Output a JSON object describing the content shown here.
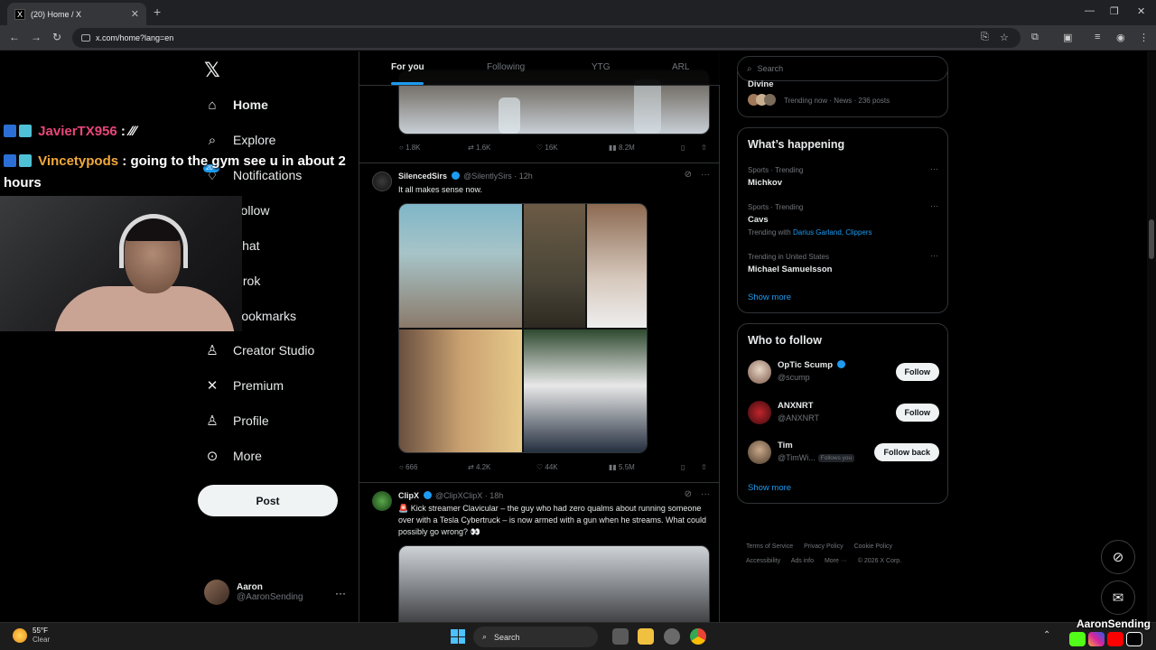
{
  "browser": {
    "tab_title": "(20) Home / X",
    "url": "x.com/home?lang=en"
  },
  "sidebar": {
    "items": [
      {
        "label": "Home",
        "icon": "home-icon",
        "active": true
      },
      {
        "label": "Explore",
        "icon": "search-icon"
      },
      {
        "label": "Notifications",
        "icon": "bell-icon"
      },
      {
        "label": "Follow",
        "icon": "follow-icon"
      },
      {
        "label": "Chat",
        "icon": "chat-icon"
      },
      {
        "label": "Grok",
        "icon": "grok-icon"
      },
      {
        "label": "Bookmarks",
        "icon": "bookmark-icon"
      },
      {
        "label": "Creator Studio",
        "icon": "creator-studio-icon"
      },
      {
        "label": "Premium",
        "icon": "x-premium-icon"
      },
      {
        "label": "Profile",
        "icon": "person-icon"
      },
      {
        "label": "More",
        "icon": "more-circle-icon"
      }
    ],
    "post_label": "Post",
    "notif_badge": "20+",
    "account": {
      "name": "Aaron",
      "handle": "@AaronSending"
    }
  },
  "overlay": {
    "chat": [
      {
        "user": "JavierTX956",
        "sep": " : ",
        "message": "∕∕∕"
      },
      {
        "user": "Vincetypods",
        "sep": " : ",
        "message": "going to the gym see u in about 2 hours"
      }
    ],
    "streamer_name": "AaronSending"
  },
  "feed": {
    "tabs": [
      "For you",
      "Following",
      "YTG",
      "ARL"
    ],
    "active_tab": "For you",
    "posts": [
      {
        "stats": {
          "replies": "1.8K",
          "reposts": "1.6K",
          "likes": "16K",
          "views": "8.2M"
        }
      },
      {
        "name": "SilencedSirs",
        "handle": "@SilentlySirs",
        "time": "12h",
        "text": "It all makes sense now.",
        "stats": {
          "replies": "666",
          "reposts": "4.2K",
          "likes": "44K",
          "views": "5.5M"
        }
      },
      {
        "name": "ClipX",
        "handle": "@ClipXClipX",
        "time": "18h",
        "text": "🚨 Kick streamer Clavicular – the guy who had zero qualms about running someone over with a Tesla Cybertruck – is now armed with a gun when he streams. What could possibly go wrong? 👀"
      }
    ]
  },
  "right": {
    "search_placeholder": "Search",
    "top_trend": {
      "name": "Divine",
      "sub": "Trending now · News · 236 posts"
    },
    "whats_happening": {
      "title": "What’s happening",
      "trends": [
        {
          "category": "Sports · Trending",
          "name": "Michkov"
        },
        {
          "category": "Sports · Trending",
          "name": "Cavs",
          "sub_prefix": "Trending with",
          "links": "Darius Garland, Clippers"
        },
        {
          "category": "Trending in United States",
          "name": "Michael Samuelsson"
        }
      ],
      "show_more": "Show more"
    },
    "who_to_follow": {
      "title": "Who to follow",
      "accounts": [
        {
          "name": "OpTic Scump",
          "handle": "@scump",
          "button": "Follow"
        },
        {
          "name": "ANXNRT",
          "handle": "@ANXNRT",
          "button": "Follow"
        },
        {
          "name": "Tim",
          "handle": "@TimWi...",
          "follows_you": "Follows you",
          "button": "Follow back"
        }
      ],
      "show_more": "Show more"
    },
    "footer": [
      "Terms of Service",
      "Privacy Policy",
      "Cookie Policy",
      "Accessibility",
      "Ads info",
      "More ···",
      "© 2026 X Corp."
    ]
  },
  "taskbar": {
    "temp": "55°F",
    "condition": "Clear",
    "search_label": "Search"
  },
  "colors": {
    "accent": "#1d9bf0",
    "background": "#000000",
    "border": "#2f3336",
    "muted_text": "#71767b"
  }
}
